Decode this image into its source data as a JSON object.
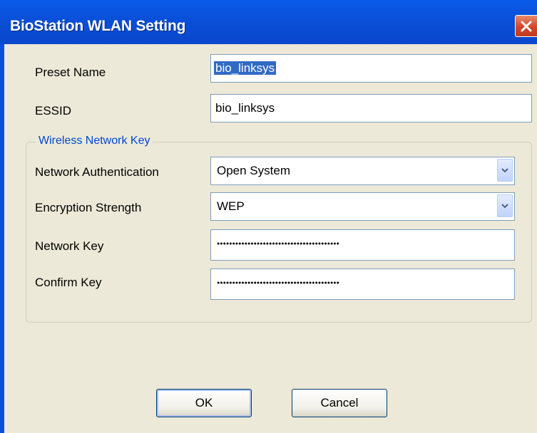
{
  "window": {
    "title": "BioStation WLAN Setting"
  },
  "form": {
    "preset_name": {
      "label": "Preset Name",
      "value": "bio_linksys"
    },
    "essid": {
      "label": "ESSID",
      "value": "bio_linksys"
    }
  },
  "wireless_key": {
    "legend": "Wireless Network Key",
    "network_authentication": {
      "label": "Network Authentication",
      "value": "Open System"
    },
    "encryption_strength": {
      "label": "Encryption Strength",
      "value": "WEP"
    },
    "network_key": {
      "label": "Network Key",
      "masked_length": 40
    },
    "confirm_key": {
      "label": "Confirm Key",
      "masked_length": 40
    }
  },
  "buttons": {
    "ok": "OK",
    "cancel": "Cancel"
  },
  "colors": {
    "titlebar": "#0a4fd8",
    "dialog_bg": "#ece9d8",
    "legend_text": "#0046d5",
    "selection": "#316ac5",
    "close_button": "#d1462a"
  },
  "icons": {
    "close": "close-icon",
    "dropdown": "chevron-down-icon"
  }
}
